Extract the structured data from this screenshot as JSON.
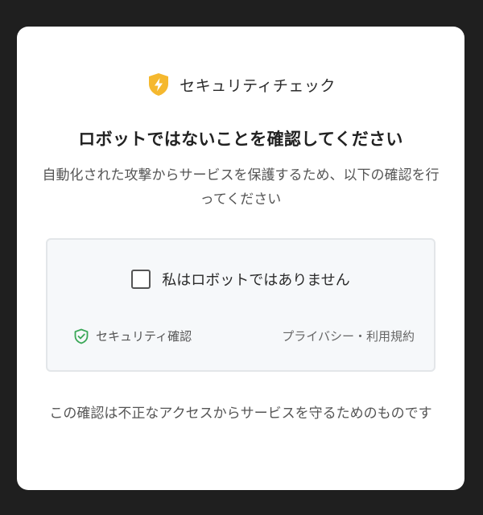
{
  "header": {
    "brand_label": "セキュリティチェック",
    "brand_icon": "shield-lightning-icon"
  },
  "title": "ロボットではないことを確認してください",
  "description": "自動化された攻撃からサービスを保護するため、以下の確認を行ってください",
  "widget": {
    "checkbox_label": "私はロボットではありません",
    "checkbox_checked": false,
    "secure_label": "セキュリティ確認",
    "secure_icon": "shield-check-icon",
    "privacy_link": "プライバシー・利用規約"
  },
  "footer_note": "この確認は不正なアクセスからサービスを守るためのものです",
  "colors": {
    "background": "#1f1f1f",
    "card": "#ffffff",
    "brand_accent": "#f5b82e",
    "secure_accent": "#3aa757",
    "widget_bg": "#f6f8fa"
  }
}
